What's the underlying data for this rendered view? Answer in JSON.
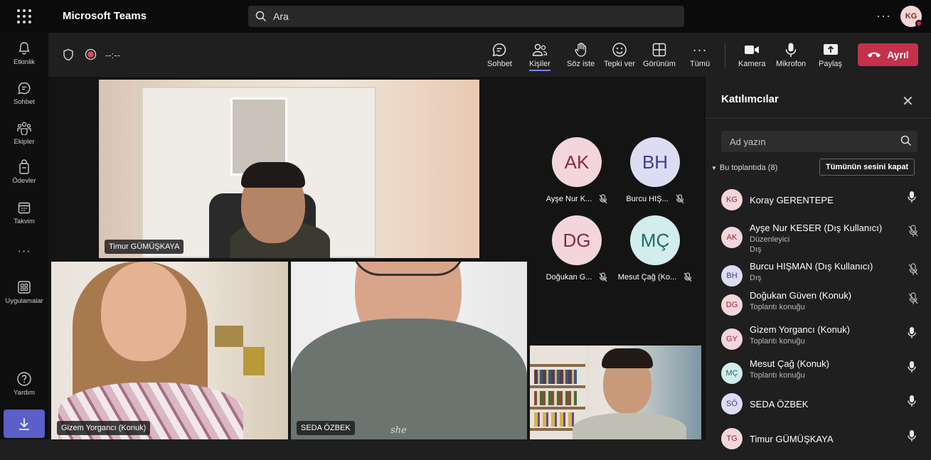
{
  "app": {
    "name": "Microsoft Teams"
  },
  "search": {
    "label": "Ara"
  },
  "user": {
    "initials": "KG"
  },
  "rail": [
    {
      "label": "Etkinlik",
      "icon": "bell-icon"
    },
    {
      "label": "Sohbet",
      "icon": "chat-icon"
    },
    {
      "label": "Ekipler",
      "icon": "teams-icon"
    },
    {
      "label": "Ödevler",
      "icon": "assignments-icon"
    },
    {
      "label": "Takvim",
      "icon": "calendar-icon"
    },
    {
      "label": "",
      "icon": "more-icon"
    },
    {
      "label": "Uygulamalar",
      "icon": "apps-icon"
    },
    {
      "label": "Yardım",
      "icon": "help-icon"
    }
  ],
  "meeting": {
    "timer": "--:--",
    "toolbar": [
      {
        "label": "Sohbet",
        "icon": "chat-icon"
      },
      {
        "label": "Kişiler",
        "icon": "people-icon"
      },
      {
        "label": "Söz iste",
        "icon": "raise-hand-icon"
      },
      {
        "label": "Tepki ver",
        "icon": "emoji-icon"
      },
      {
        "label": "Görünüm",
        "icon": "layout-icon"
      },
      {
        "label": "Tümü",
        "icon": "more-icon"
      },
      {
        "label": "Kamera",
        "icon": "camera-icon"
      },
      {
        "label": "Mikrofon",
        "icon": "mic-icon"
      },
      {
        "label": "Paylaş",
        "icon": "share-icon"
      }
    ],
    "leave_label": "Ayrıl"
  },
  "videos": [
    {
      "name": "Timur GÜMÜŞKAYA"
    },
    {
      "name": "Gizem Yorgancı (Konuk)"
    },
    {
      "name": "SEDA ÖZBEK"
    },
    {
      "name": ""
    }
  ],
  "avatar_tiles": [
    {
      "initials": "AK",
      "name": "Ayşe Nur K...",
      "bg": "#f3d6db",
      "fg": "#8a2a3c"
    },
    {
      "initials": "BH",
      "name": "Burcu HIŞ...",
      "bg": "#dcdcf2",
      "fg": "#3d3f8f"
    },
    {
      "initials": "DG",
      "name": "Doğukan G...",
      "bg": "#f3d6db",
      "fg": "#8a2a3c"
    },
    {
      "initials": "MÇ",
      "name": "Mesut Çağ (Ko...",
      "bg": "#d3ecec",
      "fg": "#1e6a6a"
    }
  ],
  "panel": {
    "title": "Katılımcılar",
    "search_label": "Ad yazın",
    "section_label": "Bu toplantıda (8)",
    "mute_all_label": "Tümünün sesini kapat",
    "people": [
      {
        "initials": "KG",
        "name": "Koray GERENTEPE",
        "role": "",
        "role2": "",
        "muted": false,
        "bg": "#f3d6db",
        "fg": "#8a2a3c"
      },
      {
        "initials": "AK",
        "name": "Ayşe Nur KESER (Dış Kullanıcı)",
        "role": "Düzenleyici",
        "role2": "Dış",
        "muted": true,
        "bg": "#f3d6db",
        "fg": "#8a2a3c"
      },
      {
        "initials": "BH",
        "name": "Burcu HIŞMAN (Dış Kullanıcı)",
        "role": "Dış",
        "role2": "",
        "muted": true,
        "bg": "#dcdcf2",
        "fg": "#3d3f8f"
      },
      {
        "initials": "DG",
        "name": "Doğukan Güven (Konuk)",
        "role": "Toplantı konuğu",
        "role2": "",
        "muted": true,
        "bg": "#f3d6db",
        "fg": "#8a2a3c"
      },
      {
        "initials": "GY",
        "name": "Gizem Yorgancı (Konuk)",
        "role": "Toplantı konuğu",
        "role2": "",
        "muted": false,
        "bg": "#f3d6db",
        "fg": "#8a2a3c"
      },
      {
        "initials": "MÇ",
        "name": "Mesut Çağ (Konuk)",
        "role": "Toplantı konuğu",
        "role2": "",
        "muted": false,
        "bg": "#d3ecec",
        "fg": "#1e6a6a"
      },
      {
        "initials": "SÖ",
        "name": "SEDA ÖZBEK",
        "role": "",
        "role2": "",
        "muted": false,
        "bg": "#dcdcf2",
        "fg": "#3d3f8f"
      },
      {
        "initials": "TG",
        "name": "Timur GÜMÜŞKAYA",
        "role": "",
        "role2": "",
        "muted": false,
        "bg": "#f3d6db",
        "fg": "#8a2a3c"
      }
    ]
  }
}
